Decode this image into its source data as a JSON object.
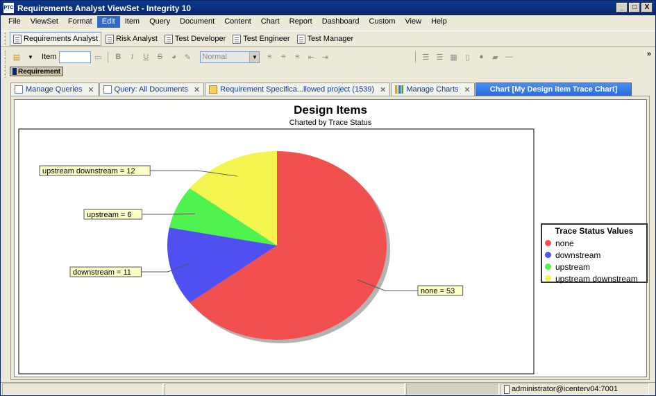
{
  "window": {
    "title": "Requirements Analyst ViewSet - Integrity 10",
    "logo": "PTC",
    "controls": [
      "_",
      "□",
      "X"
    ]
  },
  "menu": [
    "File",
    "ViewSet",
    "Format",
    "Edit",
    "Item",
    "Query",
    "Document",
    "Content",
    "Chart",
    "Report",
    "Dashboard",
    "Custom",
    "View",
    "Help"
  ],
  "perspectives": [
    {
      "label": "Requirements Analyst",
      "active": true
    },
    {
      "label": "Risk Analyst",
      "active": false
    },
    {
      "label": "Test Developer",
      "active": false
    },
    {
      "label": "Test Engineer",
      "active": false
    },
    {
      "label": "Test Manager",
      "active": false
    }
  ],
  "toolbar": {
    "item_label": "Item",
    "item_value": "",
    "style_value": "Normal",
    "overflow": "»"
  },
  "type_badge": "Requirement",
  "tabs": [
    {
      "label": "Manage Queries",
      "icon": "query-icon"
    },
    {
      "label": "Query: All Documents",
      "icon": "document-icon"
    },
    {
      "label": "Requirement Specifica...llowed project (1539)",
      "icon": "folder-icon"
    },
    {
      "label": "Manage Charts",
      "icon": "bar-chart-icon"
    },
    {
      "label": "Chart [My Design item Trace Chart]",
      "icon": "",
      "active": true
    }
  ],
  "chart_data": {
    "type": "pie",
    "title": "Design Items",
    "subtitle": "Charted by Trace Status",
    "slices": [
      {
        "name": "none",
        "value": 53,
        "label": "none = 53",
        "color": "#f25050"
      },
      {
        "name": "downstream",
        "value": 11,
        "label": "downstream = 11",
        "color": "#5050f2"
      },
      {
        "name": "upstream",
        "value": 6,
        "label": "upstream = 6",
        "color": "#50f250"
      },
      {
        "name": "upstream downstream",
        "value": 12,
        "label": "upstream downstream = 12",
        "color": "#f5f550"
      }
    ],
    "legend_title": "Trace Status Values",
    "legend_position": "right"
  },
  "status": {
    "user": "administrator@icenterv04:7001"
  }
}
